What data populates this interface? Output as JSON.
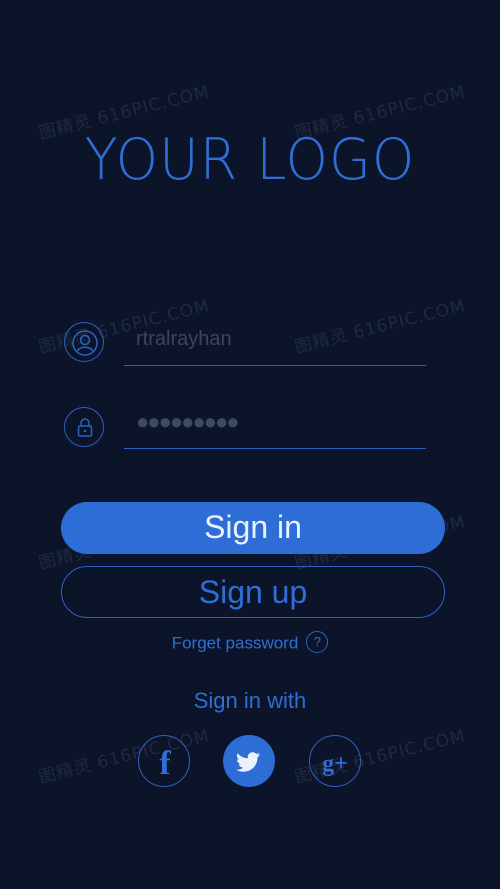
{
  "logo": "YOUR LOGO",
  "login": {
    "username_value": "rtralrayhan",
    "password_mask": "●●●●●●●●●",
    "username_icon": "user-icon",
    "password_icon": "lock-icon"
  },
  "buttons": {
    "sign_in": "Sign in",
    "sign_up": "Sign up"
  },
  "forgot": {
    "label": "Forget password",
    "help": "?"
  },
  "social": {
    "heading": "Sign in with",
    "items": [
      {
        "name": "facebook-icon",
        "glyph": "f"
      },
      {
        "name": "twitter-icon",
        "glyph": ""
      },
      {
        "name": "google-plus-icon",
        "glyph": "g+"
      }
    ]
  },
  "watermark": "图精灵 616PIC.COM",
  "colors": {
    "background": "#0b1429",
    "accent": "#2d6dd5",
    "muted_text": "#3d4658"
  }
}
